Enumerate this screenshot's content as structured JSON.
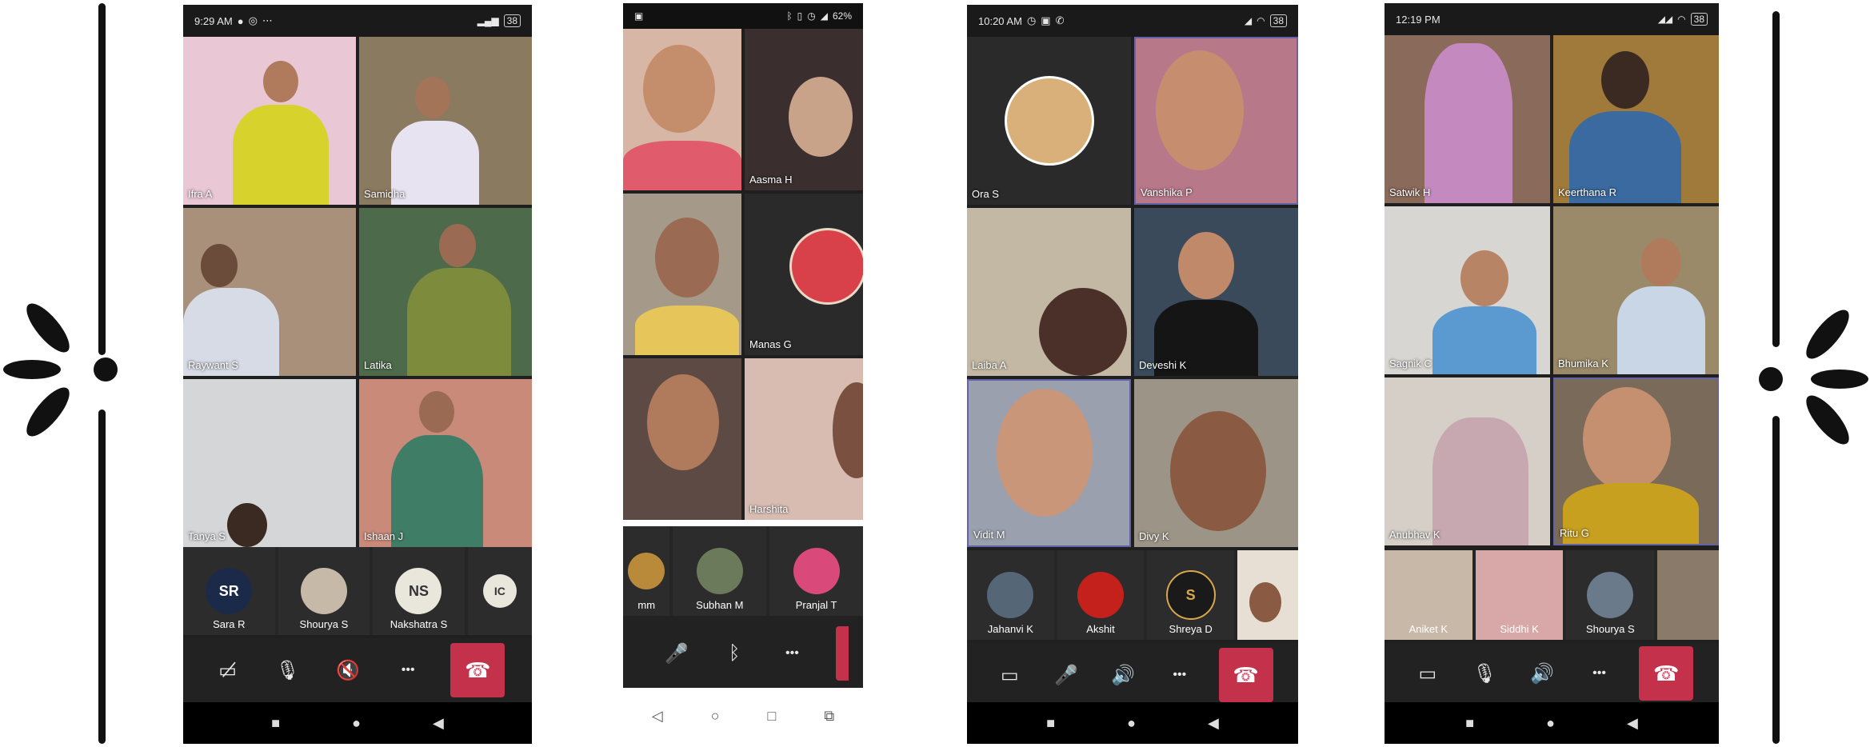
{
  "phones": [
    {
      "status_time": "9:29 AM",
      "status_extra": "⋯",
      "status_right": "38",
      "tiles": [
        {
          "name": "Ifra A"
        },
        {
          "name": "Samidha"
        },
        {
          "name": "Raywant S"
        },
        {
          "name": "Latika"
        },
        {
          "name": "Tanya S"
        },
        {
          "name": "Ishaan J"
        }
      ],
      "strip": [
        {
          "initials": "SR",
          "name": "Sara R"
        },
        {
          "initials": "",
          "name": "Shourya S"
        },
        {
          "initials": "NS",
          "name": "Nakshatra S"
        },
        {
          "initials": "IC",
          "name": ""
        }
      ]
    },
    {
      "status_right": "62%",
      "tiles": [
        {
          "name": ""
        },
        {
          "name": "Aasma H"
        },
        {
          "name": ""
        },
        {
          "name": "Manas G"
        },
        {
          "name": ""
        },
        {
          "name": "Harshita"
        }
      ],
      "strip": [
        {
          "name": "mm"
        },
        {
          "name": "Subhan M"
        },
        {
          "name": "Pranjal T"
        }
      ]
    },
    {
      "status_time": "10:20 AM",
      "status_right": "38",
      "tiles": [
        {
          "name": "Ora S"
        },
        {
          "name": "Vanshika P"
        },
        {
          "name": "Laiba A"
        },
        {
          "name": "Deveshi K"
        },
        {
          "name": "Vidit M"
        },
        {
          "name": "Divy K"
        }
      ],
      "strip": [
        {
          "name": "Jahanvi K"
        },
        {
          "name": "Akshit"
        },
        {
          "name": "Shreya D"
        },
        {
          "name": ""
        }
      ]
    },
    {
      "status_time": "12:19 PM",
      "status_right": "38",
      "tiles": [
        {
          "name": "Satwik H"
        },
        {
          "name": "Keerthana R"
        },
        {
          "name": "Sagnik C"
        },
        {
          "name": "Bhumika K"
        },
        {
          "name": "Anubhav K"
        },
        {
          "name": "Ritu G"
        }
      ],
      "strip": [
        {
          "name": "Aniket K"
        },
        {
          "name": "Siddhi K"
        },
        {
          "name": "Shourya S"
        },
        {
          "name": ""
        }
      ]
    }
  ],
  "icons": {
    "mic_off": "🎙",
    "more": "•••",
    "hangup": "☎",
    "bluetooth": "ᛒ",
    "nav_stop": "■",
    "nav_home": "●",
    "nav_back": "◀"
  },
  "colors": {
    "hangup": "#c4314b",
    "frame": "#1f1f1f",
    "teams_border": "#6264a7"
  }
}
